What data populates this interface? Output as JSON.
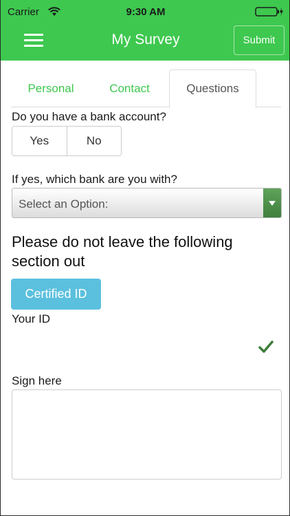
{
  "status_bar": {
    "carrier": "Carrier",
    "time": "9:30 AM"
  },
  "header": {
    "title": "My Survey",
    "submit_label": "Submit",
    "background_color": "#3ec84f"
  },
  "tabs": [
    {
      "label": "Personal",
      "active": false
    },
    {
      "label": "Contact",
      "active": false
    },
    {
      "label": "Questions",
      "active": true
    }
  ],
  "form": {
    "bank_account": {
      "question": "Do you have a bank account?",
      "options": [
        "Yes",
        "No"
      ]
    },
    "bank_select": {
      "question": "If yes, which bank are you with?",
      "selected": "Select an Option:"
    },
    "section_heading": "Please do not leave the following section out",
    "certified_id_button": "Certified ID",
    "id_label": "Your ID",
    "id_status_icon": "checkmark-icon",
    "signature_label": "Sign here"
  },
  "colors": {
    "accent": "#3ec84f",
    "info_button": "#5bc0de",
    "select_arrow": "#4a8b47"
  }
}
